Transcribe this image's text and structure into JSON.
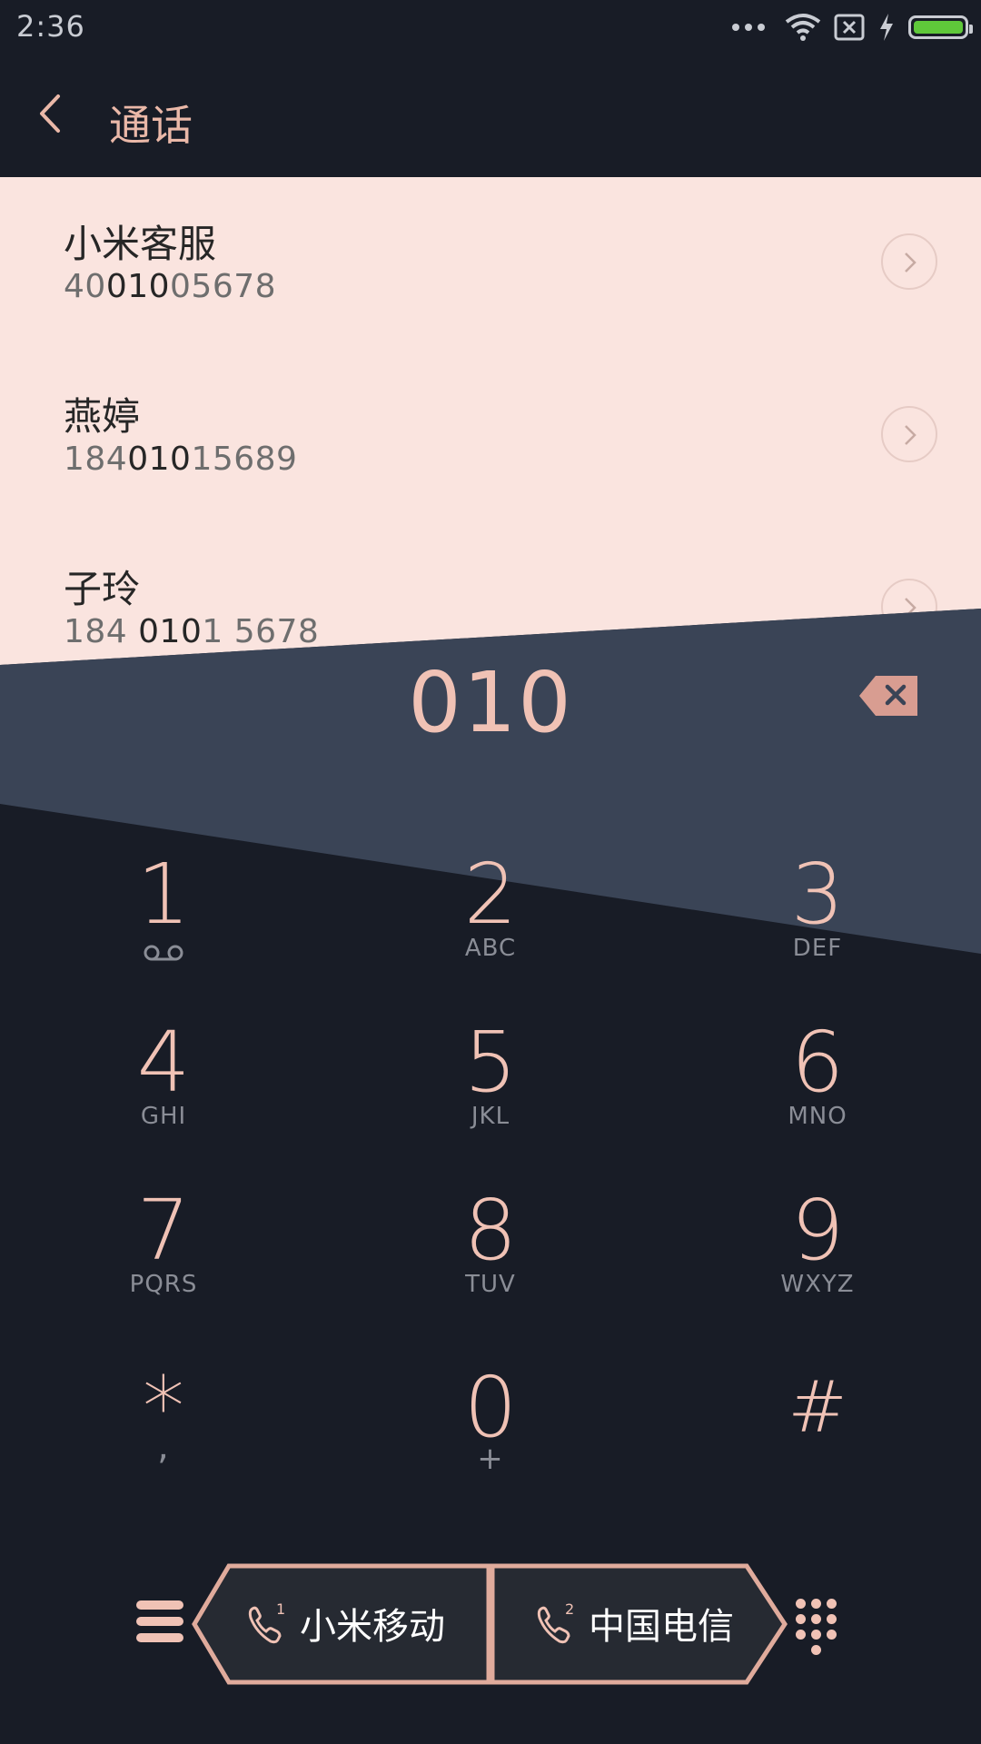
{
  "status_bar": {
    "time": "2:36",
    "icons": [
      "more-dots-icon",
      "wifi-icon",
      "no-sim-icon",
      "charging-icon",
      "battery-icon"
    ]
  },
  "header": {
    "title": "通话",
    "back_icon": "chevron-left-icon"
  },
  "results": [
    {
      "name": "小米客服",
      "number_parts": [
        [
          "40",
          false
        ],
        [
          "010",
          true
        ],
        [
          "05678",
          false
        ]
      ]
    },
    {
      "name": "燕婷",
      "number_parts": [
        [
          "184",
          false
        ],
        [
          "010",
          true
        ],
        [
          "15689",
          false
        ]
      ]
    },
    {
      "name": "子玲",
      "number_parts": [
        [
          "184 ",
          false
        ],
        [
          "010",
          true
        ],
        [
          "1 5678",
          false
        ]
      ]
    }
  ],
  "dial_input": {
    "value": "010",
    "backspace_icon": "backspace-icon"
  },
  "keypad": [
    {
      "num": "1",
      "letters": "",
      "icon": "voicemail-icon"
    },
    {
      "num": "2",
      "letters": "ABC"
    },
    {
      "num": "3",
      "letters": "DEF"
    },
    {
      "num": "4",
      "letters": "GHI"
    },
    {
      "num": "5",
      "letters": "JKL"
    },
    {
      "num": "6",
      "letters": "MNO"
    },
    {
      "num": "7",
      "letters": "PQRS"
    },
    {
      "num": "8",
      "letters": "TUV"
    },
    {
      "num": "9",
      "letters": "WXYZ"
    },
    {
      "num": "*",
      "letters": ","
    },
    {
      "num": "0",
      "letters": "+"
    },
    {
      "num": "#",
      "letters": ""
    }
  ],
  "bottom_bar": {
    "menu_icon": "menu-icon",
    "sim1": {
      "label": "小米移动",
      "slot": "1"
    },
    "sim2": {
      "label": "中国电信",
      "slot": "2"
    },
    "keypad_icon": "dialpad-icon"
  },
  "colors": {
    "background": "#181c26",
    "accent": "#f0c2b5",
    "results_bg": "#fae4df",
    "band": "#3a4456",
    "battery": "#5fc83a"
  }
}
